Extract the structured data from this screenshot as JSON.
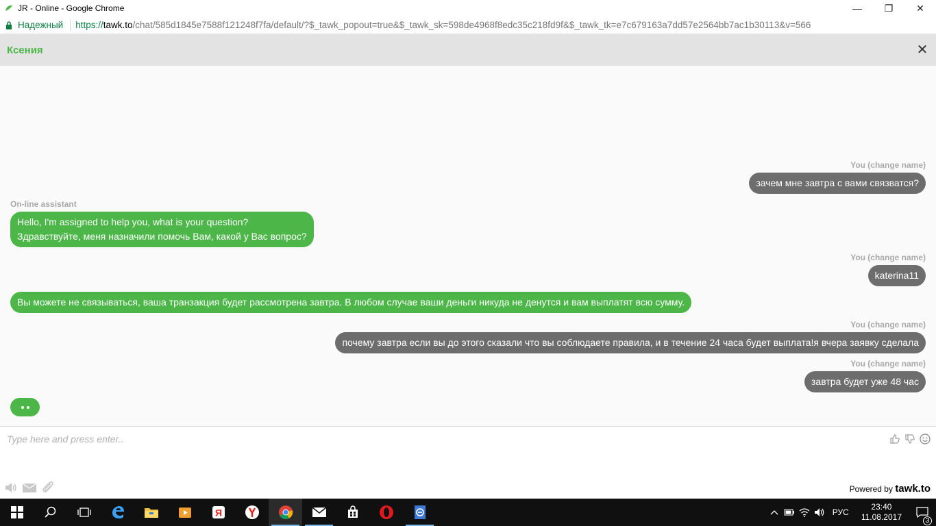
{
  "window": {
    "title": "JR - Online - Google Chrome",
    "minimize": "—",
    "maximize": "❐",
    "close": "✕"
  },
  "address_bar": {
    "secure_label": "Надежный",
    "url_scheme": "https://",
    "url_host": "tawk.to",
    "url_path": "/chat/585d1845e7588f121248f7fa/default/?$_tawk_popout=true&$_tawk_sk=598de4968f8edc35c218fd9f&$_tawk_tk=e7c679163a7dd57e2564bb7ac1b30113&v=566"
  },
  "chat_header": {
    "agent_name": "Ксения",
    "close_label": "✕"
  },
  "messages": [
    {
      "sender": "You (change name)",
      "side": "visitor",
      "lines": [
        "зачем мне завтра с вами связватся?"
      ]
    },
    {
      "sender": "On-line assistant",
      "side": "agent",
      "lines": [
        "Hello, I'm assigned to help you, what is your question?",
        "Здравствуйте, меня назначили помочь Вам, какой у Вас вопрос?"
      ]
    },
    {
      "sender": "You (change name)",
      "side": "visitor",
      "lines": [
        "katerina11"
      ]
    },
    {
      "sender": "",
      "side": "agent",
      "lines": [
        "Вы можете не связываться, ваша транзакция будет рассмотрена завтра. В любом случае ваши деньги никуда не денутся и вам выплатят всю сумму."
      ]
    },
    {
      "sender": "You (change name)",
      "side": "visitor",
      "lines": [
        "почему завтра если вы до этого сказали что вы соблюдаете правила, и в течение 24 часа будет выплата!я вчера заявку сделала"
      ]
    },
    {
      "sender": "You (change name)",
      "side": "visitor",
      "lines": [
        "завтра будет уже 48 час"
      ]
    }
  ],
  "input": {
    "placeholder": "Type here and press enter..",
    "value": ""
  },
  "footer": {
    "powered_by": "Powered by",
    "brand": "tawk.to"
  },
  "taskbar": {
    "lang": "РУС",
    "time": "23:40",
    "date": "11.08.2017",
    "notifications": "3"
  },
  "colors": {
    "agent_bubble": "#4cb748",
    "visitor_bubble": "#6d6d6d",
    "header_bg": "#e3e3e3"
  }
}
